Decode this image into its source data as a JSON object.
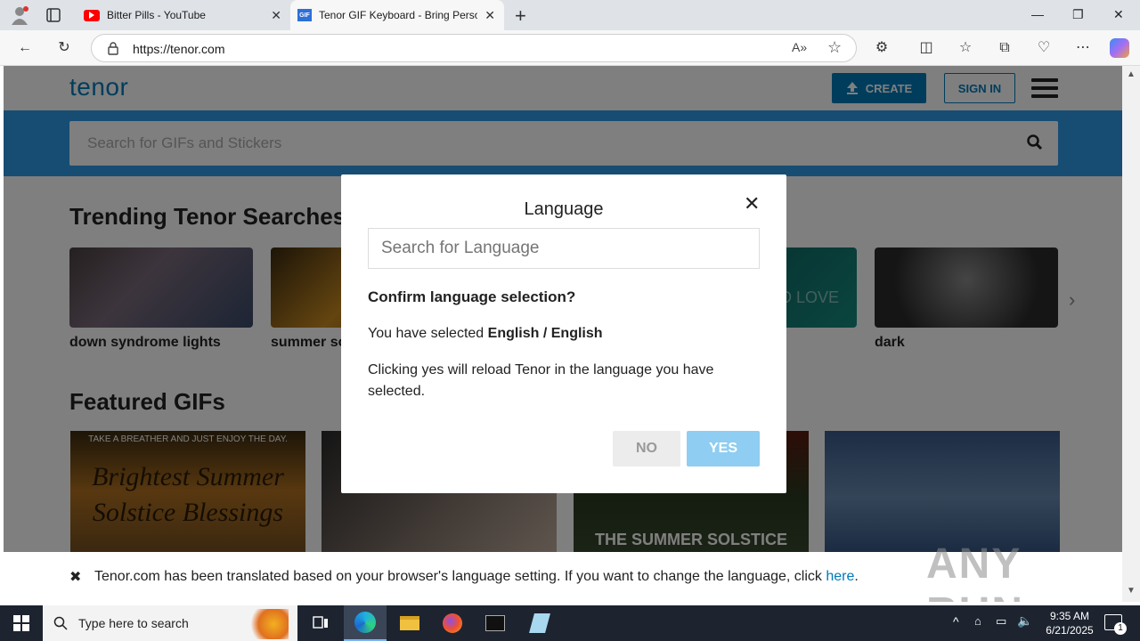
{
  "browser": {
    "tabs": [
      {
        "title": "Bitter Pills - YouTube"
      },
      {
        "title": "Tenor GIF Keyboard - Bring Perso"
      }
    ],
    "url": "https://tenor.com"
  },
  "site": {
    "logo": "tenor",
    "create_label": "CREATE",
    "signin_label": "SIGN IN",
    "search_placeholder": "Search for GIFs and Stickers",
    "trending_title": "Trending Tenor Searches",
    "trending": [
      {
        "label": "down syndrome lights"
      },
      {
        "label": "summer so"
      },
      {
        "label": "dark"
      }
    ],
    "trend_card_text": "D LOVE",
    "featured_title": "Featured GIFs",
    "featured": [
      {
        "caption_top": "TAKE A BREATHER AND JUST ENJOY THE DAY.",
        "caption_main": "Brightest Summer Solstice Blessings"
      },
      {
        "caption_main": ""
      },
      {
        "caption_main": "THE SUMMER SOLSTICE"
      },
      {
        "caption_main": ""
      }
    ],
    "notice_text": "Tenor.com has been translated based on your browser's language setting. If you want to change the language, click",
    "notice_link": "here",
    "notice_end": "."
  },
  "modal": {
    "title": "Language",
    "search_placeholder": "Search for Language",
    "question": "Confirm language selection?",
    "selected_prefix": "You have selected",
    "selected_value": "English / English",
    "explain": "Clicking yes will reload Tenor in the language you have selected.",
    "no_label": "NO",
    "yes_label": "YES"
  },
  "watermark": "ANY RUN",
  "taskbar": {
    "search_placeholder": "Type here to search",
    "time": "9:35 AM",
    "date": "6/21/2025",
    "notification_count": "1"
  },
  "colors": {
    "accent": "#007ab8",
    "search_band": "#2e9be6",
    "yes_button": "#8fcdf2"
  }
}
